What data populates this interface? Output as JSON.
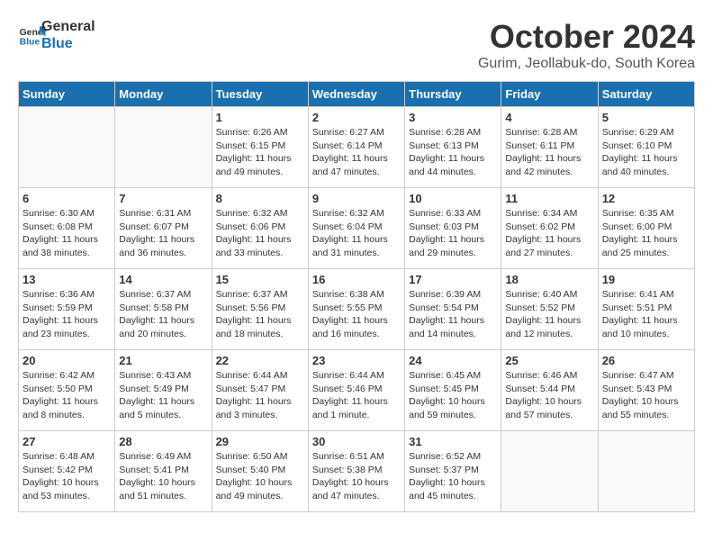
{
  "header": {
    "logo_line1": "General",
    "logo_line2": "Blue",
    "month": "October 2024",
    "location": "Gurim, Jeollabuk-do, South Korea"
  },
  "weekdays": [
    "Sunday",
    "Monday",
    "Tuesday",
    "Wednesday",
    "Thursday",
    "Friday",
    "Saturday"
  ],
  "weeks": [
    [
      {
        "day": "",
        "sunrise": "",
        "sunset": "",
        "daylight": ""
      },
      {
        "day": "",
        "sunrise": "",
        "sunset": "",
        "daylight": ""
      },
      {
        "day": "1",
        "sunrise": "Sunrise: 6:26 AM",
        "sunset": "Sunset: 6:15 PM",
        "daylight": "Daylight: 11 hours and 49 minutes."
      },
      {
        "day": "2",
        "sunrise": "Sunrise: 6:27 AM",
        "sunset": "Sunset: 6:14 PM",
        "daylight": "Daylight: 11 hours and 47 minutes."
      },
      {
        "day": "3",
        "sunrise": "Sunrise: 6:28 AM",
        "sunset": "Sunset: 6:13 PM",
        "daylight": "Daylight: 11 hours and 44 minutes."
      },
      {
        "day": "4",
        "sunrise": "Sunrise: 6:28 AM",
        "sunset": "Sunset: 6:11 PM",
        "daylight": "Daylight: 11 hours and 42 minutes."
      },
      {
        "day": "5",
        "sunrise": "Sunrise: 6:29 AM",
        "sunset": "Sunset: 6:10 PM",
        "daylight": "Daylight: 11 hours and 40 minutes."
      }
    ],
    [
      {
        "day": "6",
        "sunrise": "Sunrise: 6:30 AM",
        "sunset": "Sunset: 6:08 PM",
        "daylight": "Daylight: 11 hours and 38 minutes."
      },
      {
        "day": "7",
        "sunrise": "Sunrise: 6:31 AM",
        "sunset": "Sunset: 6:07 PM",
        "daylight": "Daylight: 11 hours and 36 minutes."
      },
      {
        "day": "8",
        "sunrise": "Sunrise: 6:32 AM",
        "sunset": "Sunset: 6:06 PM",
        "daylight": "Daylight: 11 hours and 33 minutes."
      },
      {
        "day": "9",
        "sunrise": "Sunrise: 6:32 AM",
        "sunset": "Sunset: 6:04 PM",
        "daylight": "Daylight: 11 hours and 31 minutes."
      },
      {
        "day": "10",
        "sunrise": "Sunrise: 6:33 AM",
        "sunset": "Sunset: 6:03 PM",
        "daylight": "Daylight: 11 hours and 29 minutes."
      },
      {
        "day": "11",
        "sunrise": "Sunrise: 6:34 AM",
        "sunset": "Sunset: 6:02 PM",
        "daylight": "Daylight: 11 hours and 27 minutes."
      },
      {
        "day": "12",
        "sunrise": "Sunrise: 6:35 AM",
        "sunset": "Sunset: 6:00 PM",
        "daylight": "Daylight: 11 hours and 25 minutes."
      }
    ],
    [
      {
        "day": "13",
        "sunrise": "Sunrise: 6:36 AM",
        "sunset": "Sunset: 5:59 PM",
        "daylight": "Daylight: 11 hours and 23 minutes."
      },
      {
        "day": "14",
        "sunrise": "Sunrise: 6:37 AM",
        "sunset": "Sunset: 5:58 PM",
        "daylight": "Daylight: 11 hours and 20 minutes."
      },
      {
        "day": "15",
        "sunrise": "Sunrise: 6:37 AM",
        "sunset": "Sunset: 5:56 PM",
        "daylight": "Daylight: 11 hours and 18 minutes."
      },
      {
        "day": "16",
        "sunrise": "Sunrise: 6:38 AM",
        "sunset": "Sunset: 5:55 PM",
        "daylight": "Daylight: 11 hours and 16 minutes."
      },
      {
        "day": "17",
        "sunrise": "Sunrise: 6:39 AM",
        "sunset": "Sunset: 5:54 PM",
        "daylight": "Daylight: 11 hours and 14 minutes."
      },
      {
        "day": "18",
        "sunrise": "Sunrise: 6:40 AM",
        "sunset": "Sunset: 5:52 PM",
        "daylight": "Daylight: 11 hours and 12 minutes."
      },
      {
        "day": "19",
        "sunrise": "Sunrise: 6:41 AM",
        "sunset": "Sunset: 5:51 PM",
        "daylight": "Daylight: 11 hours and 10 minutes."
      }
    ],
    [
      {
        "day": "20",
        "sunrise": "Sunrise: 6:42 AM",
        "sunset": "Sunset: 5:50 PM",
        "daylight": "Daylight: 11 hours and 8 minutes."
      },
      {
        "day": "21",
        "sunrise": "Sunrise: 6:43 AM",
        "sunset": "Sunset: 5:49 PM",
        "daylight": "Daylight: 11 hours and 5 minutes."
      },
      {
        "day": "22",
        "sunrise": "Sunrise: 6:44 AM",
        "sunset": "Sunset: 5:47 PM",
        "daylight": "Daylight: 11 hours and 3 minutes."
      },
      {
        "day": "23",
        "sunrise": "Sunrise: 6:44 AM",
        "sunset": "Sunset: 5:46 PM",
        "daylight": "Daylight: 11 hours and 1 minute."
      },
      {
        "day": "24",
        "sunrise": "Sunrise: 6:45 AM",
        "sunset": "Sunset: 5:45 PM",
        "daylight": "Daylight: 10 hours and 59 minutes."
      },
      {
        "day": "25",
        "sunrise": "Sunrise: 6:46 AM",
        "sunset": "Sunset: 5:44 PM",
        "daylight": "Daylight: 10 hours and 57 minutes."
      },
      {
        "day": "26",
        "sunrise": "Sunrise: 6:47 AM",
        "sunset": "Sunset: 5:43 PM",
        "daylight": "Daylight: 10 hours and 55 minutes."
      }
    ],
    [
      {
        "day": "27",
        "sunrise": "Sunrise: 6:48 AM",
        "sunset": "Sunset: 5:42 PM",
        "daylight": "Daylight: 10 hours and 53 minutes."
      },
      {
        "day": "28",
        "sunrise": "Sunrise: 6:49 AM",
        "sunset": "Sunset: 5:41 PM",
        "daylight": "Daylight: 10 hours and 51 minutes."
      },
      {
        "day": "29",
        "sunrise": "Sunrise: 6:50 AM",
        "sunset": "Sunset: 5:40 PM",
        "daylight": "Daylight: 10 hours and 49 minutes."
      },
      {
        "day": "30",
        "sunrise": "Sunrise: 6:51 AM",
        "sunset": "Sunset: 5:38 PM",
        "daylight": "Daylight: 10 hours and 47 minutes."
      },
      {
        "day": "31",
        "sunrise": "Sunrise: 6:52 AM",
        "sunset": "Sunset: 5:37 PM",
        "daylight": "Daylight: 10 hours and 45 minutes."
      },
      {
        "day": "",
        "sunrise": "",
        "sunset": "",
        "daylight": ""
      },
      {
        "day": "",
        "sunrise": "",
        "sunset": "",
        "daylight": ""
      }
    ]
  ]
}
